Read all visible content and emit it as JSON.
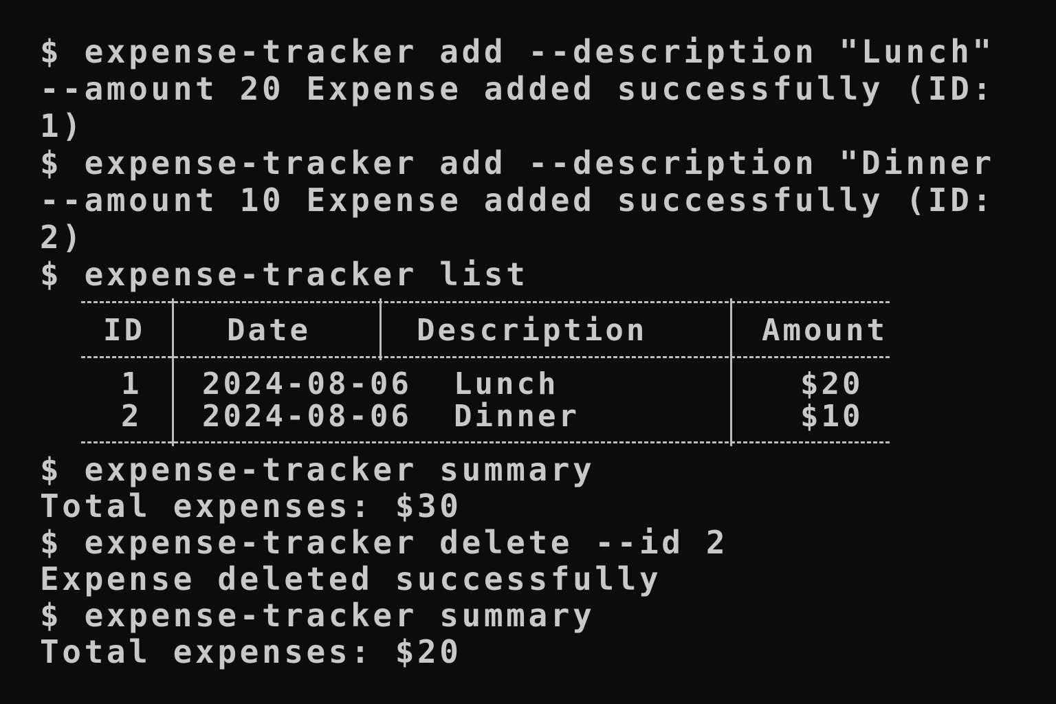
{
  "terminal": {
    "lines": [
      "$ expense-tracker add --description \"Lunch\"",
      "--amount 20 Expense added successfully (ID:",
      "1)",
      "$ expense-tracker add --description \"Dinner",
      "--amount 10 Expense added successfully (ID:",
      "2)",
      "$ expense-tracker list"
    ],
    "table": {
      "headers": [
        "ID",
        "Date",
        "Description",
        "Amount"
      ],
      "rows": [
        {
          "id": "1",
          "date": "2024-08-06",
          "description": "Lunch",
          "amount": "$20"
        },
        {
          "id": "2",
          "date": "2024-08-06",
          "description": "Dinner",
          "amount": "$10"
        }
      ]
    },
    "after_lines": [
      "$ expense-tracker summary",
      "Total expenses: $30",
      "$ expense-tracker delete --id 2",
      "Expense deleted successfully",
      "$ expense-tracker summary",
      "Total expenses: $20"
    ]
  },
  "colors": {
    "background": "#0c0c0c",
    "text": "#c8c8c8"
  }
}
